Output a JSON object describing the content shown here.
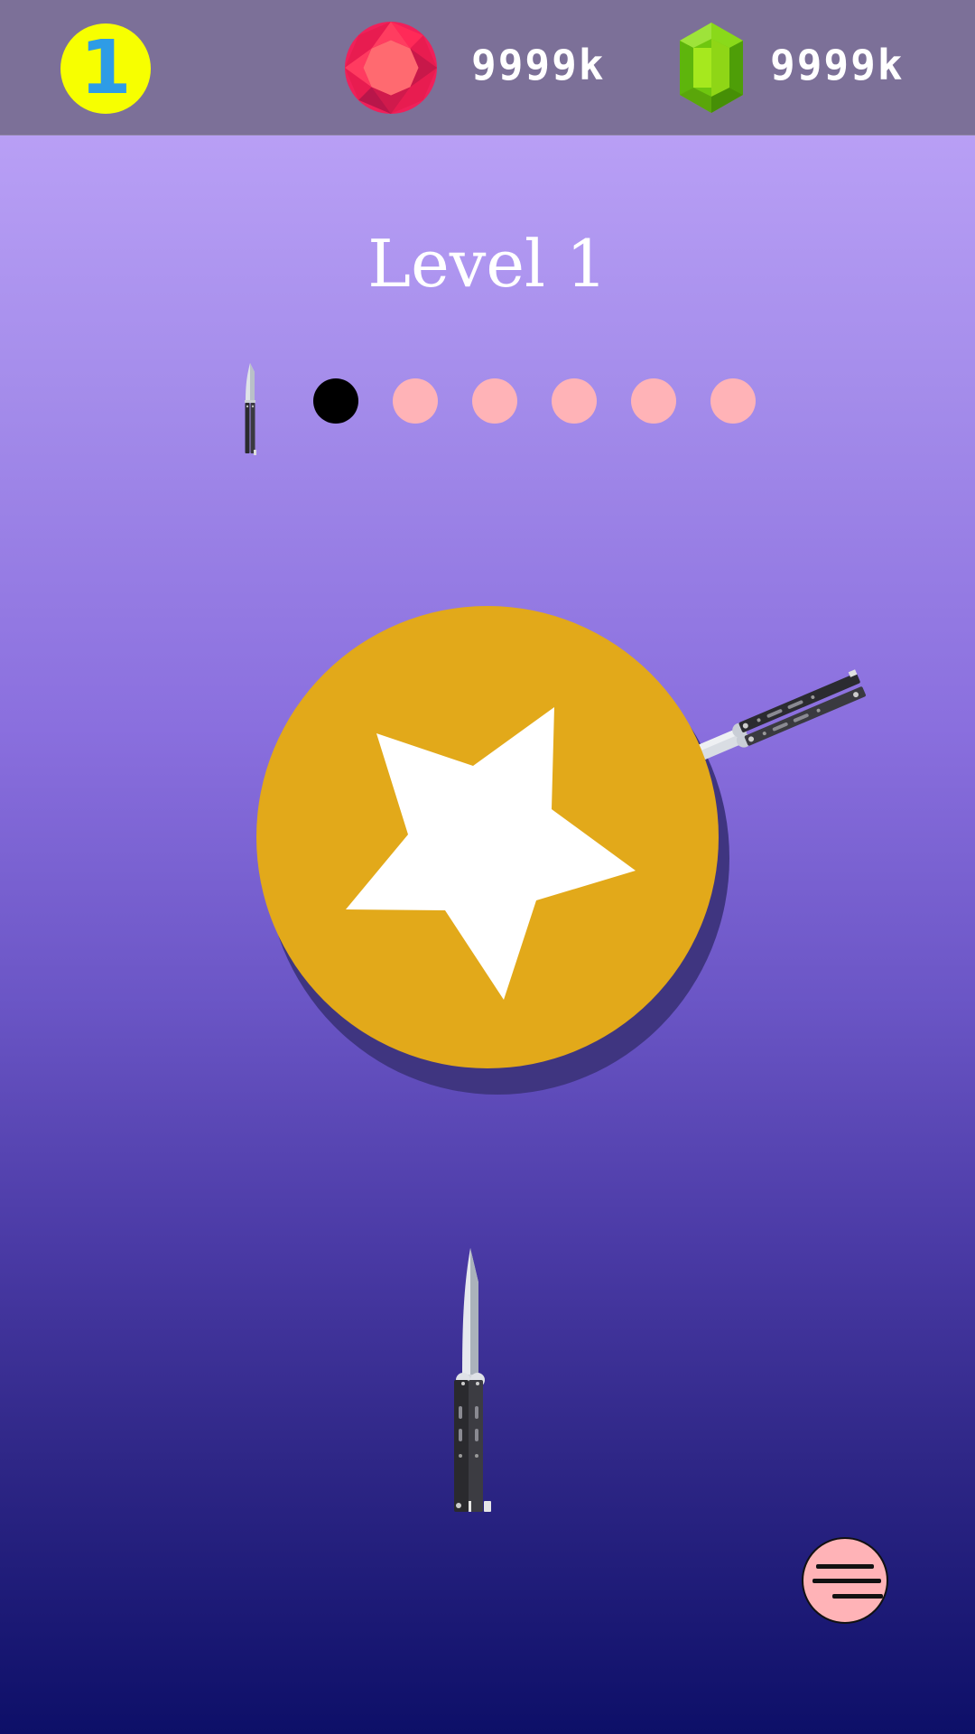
{
  "hud": {
    "level_badge": "1",
    "ruby_count": "9999k",
    "emerald_count": "9999k",
    "ruby_icon": "ruby-gem-icon",
    "emerald_icon": "emerald-gem-icon"
  },
  "level": {
    "title": "Level 1"
  },
  "progress": {
    "knife_icon": "knife-icon",
    "stages_total": 6,
    "current_stage": 1,
    "dot_colors": {
      "current": "#000000",
      "pending": "#ffb3b7"
    }
  },
  "target": {
    "icon": "star-icon",
    "wheel_color": "#e2a91a",
    "star_color": "#ffffff",
    "stuck_knives": 1
  },
  "knives_remaining_in_hand": 1,
  "menu": {
    "icon": "menu-icon"
  },
  "colors": {
    "top_bar": "#7c7098",
    "level_badge_bg": "#f7ff00",
    "level_badge_text": "#2e9ce6",
    "background_top": "#c3a9fb",
    "background_bottom": "#0d0f68"
  }
}
